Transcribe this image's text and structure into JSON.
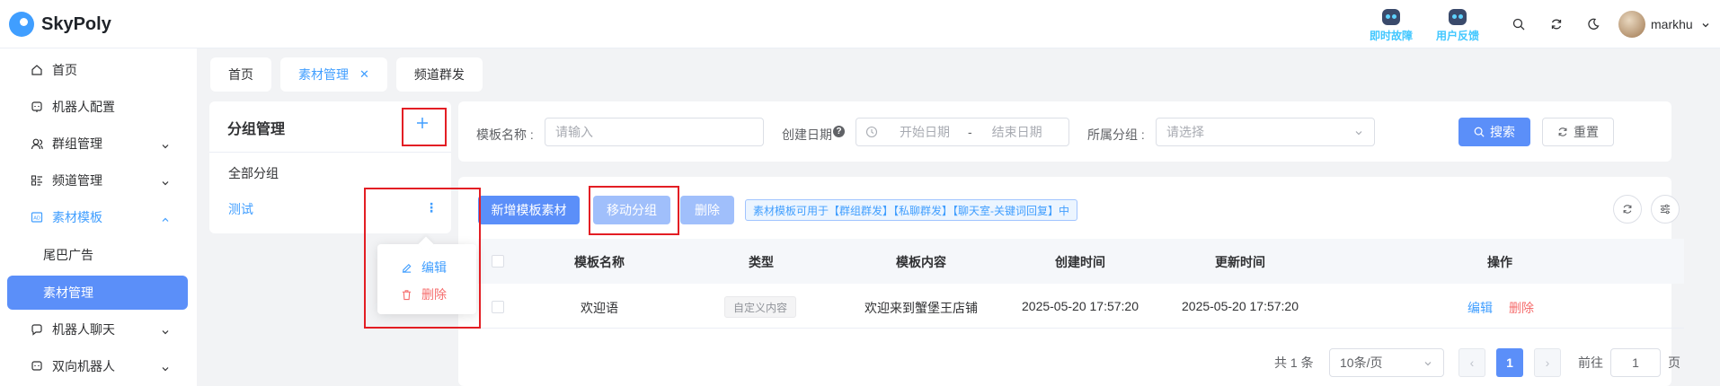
{
  "app": {
    "name": "SkyPoly",
    "brand_color": "#409eff",
    "accent_color": "#5b8ff9"
  },
  "header": {
    "tools": [
      {
        "label": "即时故障",
        "icon": "robot-icon"
      },
      {
        "label": "用户反馈",
        "icon": "robot-icon"
      }
    ],
    "icons": [
      "search-icon",
      "refresh-icon",
      "moon-icon"
    ],
    "user": {
      "name": "markhu"
    }
  },
  "sidebar": {
    "items": [
      {
        "label": "首页",
        "icon": "home-icon"
      },
      {
        "label": "机器人配置",
        "icon": "robot-config-icon"
      },
      {
        "label": "群组管理",
        "icon": "users-icon"
      },
      {
        "label": "频道管理",
        "icon": "list-icon"
      },
      {
        "label": "素材模板",
        "icon": "template-icon"
      },
      {
        "label": "尾巴广告"
      },
      {
        "label": "素材管理"
      },
      {
        "label": "机器人聊天",
        "icon": "chat-icon"
      },
      {
        "label": "双向机器人",
        "icon": "robot-icon"
      }
    ]
  },
  "tabs": [
    {
      "label": "首页"
    },
    {
      "label": "素材管理",
      "active": true
    },
    {
      "label": "频道群发"
    }
  ],
  "group_panel": {
    "title": "分组管理",
    "add_symbol": "+",
    "items": [
      {
        "label": "全部分组"
      },
      {
        "label": "测试",
        "selected": true
      }
    ],
    "menu": {
      "edit": "编辑",
      "delete": "删除"
    }
  },
  "search": {
    "template_name_label": "模板名称 :",
    "template_name_placeholder": "请输入",
    "created_date_label": "创建日期",
    "start_placeholder": "开始日期",
    "separator": "-",
    "end_placeholder": "结束日期",
    "group_label": "所属分组 :",
    "group_placeholder": "请选择",
    "search_button": "搜索",
    "reset_button": "重置"
  },
  "toolbar": {
    "add_button": "新增模板素材",
    "move_button": "移动分组",
    "delete_button": "删除",
    "tip": "素材模板可用于【群组群发】【私聊群发】【聊天室-关键词回复】中"
  },
  "table": {
    "columns": [
      "模板名称",
      "类型",
      "模板内容",
      "创建时间",
      "更新时间",
      "操作"
    ],
    "rows": [
      {
        "name": "欢迎语",
        "type": "自定义内容",
        "content": "欢迎来到蟹堡王店铺",
        "created": "2025-05-20 17:57:20",
        "updated": "2025-05-20 17:57:20",
        "actions": {
          "edit": "编辑",
          "delete": "删除"
        }
      }
    ]
  },
  "pagination": {
    "total": "共 1 条",
    "page_size": "10条/页",
    "current_page": "1",
    "goto_label": "前往",
    "goto_value": "1",
    "page_suffix": "页"
  }
}
